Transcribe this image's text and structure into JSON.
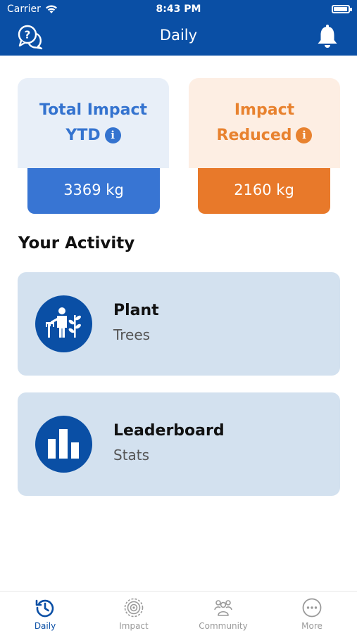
{
  "status_bar": {
    "carrier": "Carrier",
    "time": "8:43 PM",
    "battery_level": 0.95
  },
  "nav": {
    "title": "Daily",
    "left_icon": "help-chat-icon",
    "right_icon": "bell-icon"
  },
  "summary": {
    "total": {
      "line1": "Total Impact",
      "line2": "YTD",
      "info": "i",
      "value": "3369 kg"
    },
    "reduced": {
      "line1": "Impact",
      "line2": "Reduced",
      "info": "i",
      "value": "2160 kg"
    }
  },
  "activity": {
    "title": "Your Activity",
    "items": [
      {
        "title": "Plant",
        "subtitle": "Trees",
        "icon": "plant-trees-icon"
      },
      {
        "title": "Leaderboard",
        "subtitle": "Stats",
        "icon": "bar-chart-icon"
      }
    ]
  },
  "tabs": [
    {
      "label": "Daily",
      "icon": "history-clock-icon",
      "active": true
    },
    {
      "label": "Impact",
      "icon": "impact-target-icon",
      "active": false
    },
    {
      "label": "Community",
      "icon": "community-icon",
      "active": false
    },
    {
      "label": "More",
      "icon": "more-dots-icon",
      "active": false
    }
  ],
  "colors": {
    "brand_blue": "#0a4fa5",
    "total_card_bg": "#e8eff8",
    "total_text": "#3473cf",
    "total_value_bg": "#3875d3",
    "reduced_card_bg": "#fdeee3",
    "reduced_text": "#e8822f",
    "reduced_value_bg": "#e8792a",
    "activity_card_bg": "#d3e1ef",
    "tab_inactive": "#9a9a9a"
  }
}
